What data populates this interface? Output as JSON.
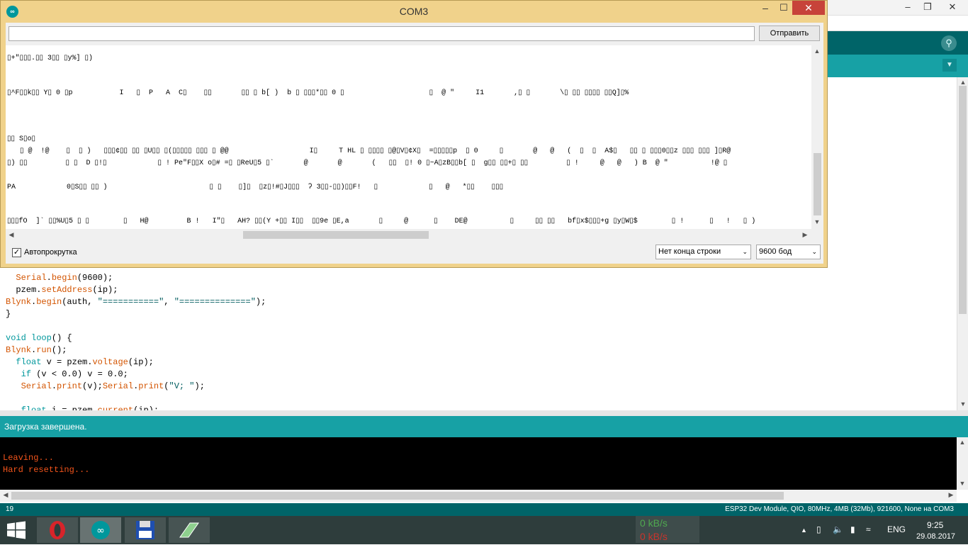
{
  "com_window": {
    "title": "COM3",
    "minimize_icon": "minimize-icon",
    "maximize_icon": "maximize-icon",
    "close_icon": "close-icon",
    "send_input_value": "",
    "send_button_label": "Отправить",
    "output_lines": [
      "▯+\"▯▯▯.▯▯ 3▯▯ ▯y%] ▯)",
      "▯^F▯▯k▯▯ Y▯ 0 ▯p           I   ▯  P   A  C▯    ▯▯       ▯▯ ▯ b[ )  b ▯ ▯▯▯*▯▯ 0 ▯                    ▯  @ \"     I1       ,▯ ▯       \\▯ ▯▯ ▯▯▯▯ ▯▯Q]▯%",
      "▯▯ S▯o▯",
      "   ▯ @  !@    ▯  ▯ )   ▯▯▯¢▯▯ ▯▯ ▯U▯▯ ▯(▯▯▯▯▯ ▯▯▯ ▯ @@                   I▯     T HL ▯ ▯▯▯▯ ▯@▯V▯¢X▯  =▯▯▯▯▯p  ▯ 0     ▯       @   @   (  ▯  ▯  A$▯   ▯▯ ▯ ▯▯▯0▯▯z ▯▯▯ ▯▯▯ ]▯R@",
      "▯) ▯▯         ▯ ▯  D ▯!▯            ▯ ! Pe\"F▯▯X o▯# =▯ ▯ReU▯5 ▯`       @       @       (   ▯▯  ▯! 0 ▯~A▯zB▯▯b[ ▯  g▯▯ ▯▯+▯ ▯▯         ▯ !     @   @   ) B  @ \"          !@ ▯",
      "PA            0▯S▯▯ ▯▯ )                        ▯ ▯    ▯]▯  ▯z▯!#▯J▯▯▯  ʔ 3▯▯-▯▯)▯▯F!   ▯            ▯   @   *▯▯    ▯▯▯",
      "▯▯▯fO  ]` ▯▯%U▯5 ▯ ▯        ▯   H@         B !   I\"▯   AH? ▯▯(Y +▯▯ I▯▯  ▯▯9e ▯E,a       ▯     @      ▯    DE@          ▯     ▯▯ ▯▯   bf▯x$▯▯▯+g ▯y▯W▯$        ▯ !      ▯   !   ▯ )"
    ],
    "autoscroll_checked": true,
    "autoscroll_label": "Автопрокрутка",
    "line_ending_selected": "Нет конца строки",
    "baud_selected": "9600 бод"
  },
  "editor": {
    "lines": [
      {
        "parts": [
          {
            "t": "  "
          },
          {
            "t": "Serial",
            "c": "kw"
          },
          {
            "t": "."
          },
          {
            "t": "begin",
            "c": "kw"
          },
          {
            "t": "(9600);"
          }
        ]
      },
      {
        "parts": [
          {
            "t": "  pzem."
          },
          {
            "t": "setAddress",
            "c": "kw"
          },
          {
            "t": "(ip);"
          }
        ]
      },
      {
        "parts": [
          {
            "t": "Blynk",
            "c": "kw"
          },
          {
            "t": "."
          },
          {
            "t": "begin",
            "c": "kw"
          },
          {
            "t": "(auth, "
          },
          {
            "t": "\"===========\"",
            "c": "st"
          },
          {
            "t": ", "
          },
          {
            "t": "\"==============\"",
            "c": "st"
          },
          {
            "t": ");"
          }
        ]
      },
      {
        "parts": [
          {
            "t": "}"
          }
        ]
      },
      {
        "parts": [
          {
            "t": ""
          }
        ]
      },
      {
        "parts": [
          {
            "t": "void",
            "c": "ty"
          },
          {
            "t": " "
          },
          {
            "t": "loop",
            "c": "ty"
          },
          {
            "t": "() {"
          }
        ]
      },
      {
        "parts": [
          {
            "t": "Blynk",
            "c": "kw"
          },
          {
            "t": "."
          },
          {
            "t": "run",
            "c": "kw"
          },
          {
            "t": "();"
          }
        ]
      },
      {
        "parts": [
          {
            "t": "  "
          },
          {
            "t": "float",
            "c": "ty"
          },
          {
            "t": " v = pzem."
          },
          {
            "t": "voltage",
            "c": "kw"
          },
          {
            "t": "(ip);"
          }
        ]
      },
      {
        "parts": [
          {
            "t": "   "
          },
          {
            "t": "if",
            "c": "ty"
          },
          {
            "t": " (v < 0.0) v = 0.0;"
          }
        ]
      },
      {
        "parts": [
          {
            "t": "   "
          },
          {
            "t": "Serial",
            "c": "kw"
          },
          {
            "t": "."
          },
          {
            "t": "print",
            "c": "kw"
          },
          {
            "t": "(v);"
          },
          {
            "t": "Serial",
            "c": "kw"
          },
          {
            "t": "."
          },
          {
            "t": "print",
            "c": "kw"
          },
          {
            "t": "("
          },
          {
            "t": "\"V; \"",
            "c": "st"
          },
          {
            "t": ");"
          }
        ]
      },
      {
        "parts": [
          {
            "t": ""
          }
        ]
      },
      {
        "parts": [
          {
            "t": "   "
          },
          {
            "t": "float",
            "c": "ty"
          },
          {
            "t": " i = pzem."
          },
          {
            "t": "current",
            "c": "kw"
          },
          {
            "t": "(ip);"
          }
        ]
      }
    ]
  },
  "status": {
    "message": "Загрузка завершена."
  },
  "console": {
    "lines": [
      "Leaving...",
      "Hard resetting..."
    ]
  },
  "bottom_bar": {
    "line_number": "19",
    "board_info": "ESP32 Dev Module, QIO, 80MHz, 4MB (32Mb), 921600, None на COM3"
  },
  "taskbar": {
    "net_up": "0 kB/s",
    "net_down": "0 kB/s",
    "language": "ENG",
    "time": "9:25",
    "date": "29.08.2017"
  },
  "colors": {
    "ide_teal": "#17a1a5",
    "ide_dark_teal": "#006468",
    "console_text": "#f2541b",
    "window_frame": "#f0d28b",
    "close_red": "#c7433a"
  }
}
